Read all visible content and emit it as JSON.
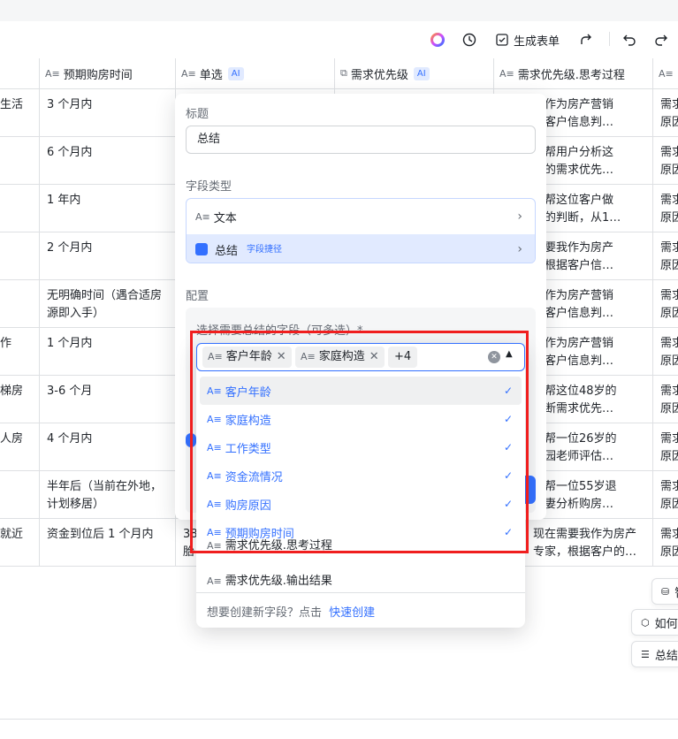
{
  "toolbar": {
    "generate_form": "生成表单"
  },
  "columns": {
    "c1": "预期购房时间",
    "c2": "单选",
    "c2_tag": "AI",
    "c3": "需求优先级",
    "c3_tag": "AI",
    "c4": "需求优先级.思考过程"
  },
  "rows": [
    {
      "c0": "生活",
      "c1": "3 个月内",
      "c4a": "我作为房产营销",
      "c4b": "据客户信息判…",
      "c5a": "需求",
      "c5b": "原因"
    },
    {
      "c0": "",
      "c1": "6 个月内",
      "c4a": "要帮用户分析这",
      "c4b": "户的需求优先…",
      "c5a": "需求",
      "c5b": "原因"
    },
    {
      "c0": "",
      "c1": "1 年内",
      "c4a": "要帮这位客户做",
      "c4b": "级的判断，从1…",
      "c5a": "需求",
      "c5b": "原因"
    },
    {
      "c0": "",
      "c1": "2 个月内",
      "c4a": "需要我作为房产",
      "c4b": "，根据客户信…",
      "c5a": "需求",
      "c5b": "原因"
    },
    {
      "c0": "",
      "c1": "无明确时间（遇合适房源即入手）",
      "c4a": "我作为房产营销",
      "c4b": "据客户信息判…",
      "c5a": "需求",
      "c5b": "原因"
    },
    {
      "c0": "作",
      "c1": "1 个月内",
      "c4a": "我作为房产营销",
      "c4b": "据客户信息判…",
      "c5a": "需求",
      "c5b": "原因"
    },
    {
      "c0": "梯房",
      "c1": "3-6 个月",
      "c4a": "要帮这位48岁的",
      "c4b": "判断需求优先…",
      "c5a": "需求",
      "c5b": "原因"
    },
    {
      "c0": "人房",
      "c1": "4 个月内",
      "c4a": "要帮一位26岁的",
      "c4b": "儿园老师评估…",
      "c5a": "需求",
      "c5b": "原因"
    },
    {
      "c0": "",
      "c1": "半年后（当前在外地，计划移居）",
      "c4a": "要帮一位55岁退",
      "c4b": "夫妻分析购房…",
      "c5a": "需求",
      "c5b": "原因"
    },
    {
      "c0": "就近",
      "c1": "资金到位后 1 个月内",
      "c2": "38",
      "c2b": "胎",
      "c4a": "现在需要我作为房产",
      "c4b": "专家，根据客户的…",
      "c5a": "需求",
      "c5b": "原因"
    }
  ],
  "panel": {
    "title_label": "标题",
    "title_value": "总结",
    "field_type_label": "字段类型",
    "type_text": "文本",
    "type_summary": "总结",
    "type_summary_tag": "字段捷径",
    "config_label": "配置",
    "select_label": "选择需要总结的字段（可多选）*"
  },
  "dropdown": {
    "chips": [
      "客户年龄",
      "家庭构造"
    ],
    "more": "+4",
    "options": [
      "客户年龄",
      "家庭构造",
      "工作类型",
      "资金流情况",
      "购房原因",
      "预期购房时间"
    ],
    "extra_options": [
      "需求优先级.思考过程",
      "需求优先级.输出结果"
    ],
    "footer_text": "想要创建新字段？点击",
    "footer_link": "快速创建"
  },
  "float_buttons": {
    "b1": "智",
    "b2": "如何使",
    "b3": "总结主"
  },
  "colors": {
    "accent": "#3370ff",
    "highlight": "#f01e1e"
  }
}
